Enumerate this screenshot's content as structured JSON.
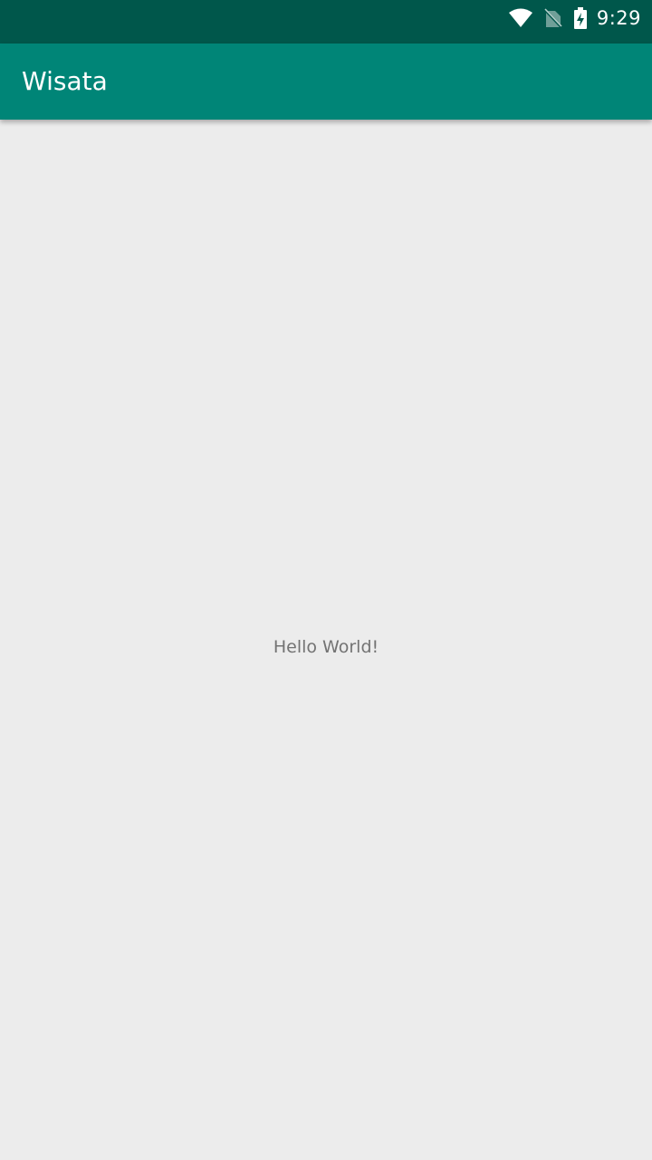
{
  "status_bar": {
    "time": "9:29",
    "icons": [
      "wifi-icon",
      "no-sim-icon",
      "battery-charging-icon"
    ],
    "background_color": "#00574b"
  },
  "app_bar": {
    "title": "Wisata",
    "background_color": "#008577"
  },
  "main": {
    "message": "Hello World!",
    "background_color": "#ececec"
  }
}
